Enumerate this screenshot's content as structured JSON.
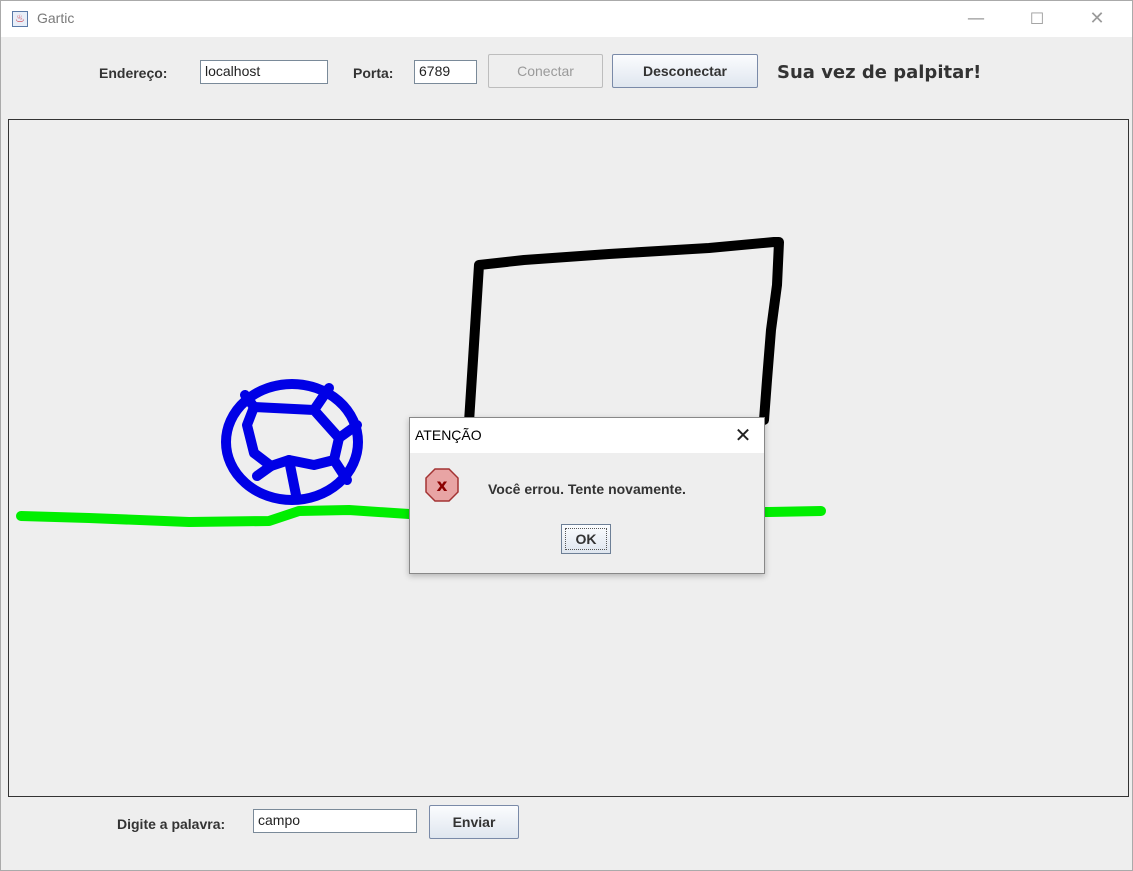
{
  "window": {
    "title": "Gartic",
    "icon": "java-app-icon",
    "controls": {
      "minimize": "—",
      "maximize": "☐",
      "close": "✕"
    }
  },
  "connection": {
    "address_label": "Endereço:",
    "address_value": "localhost",
    "port_label": "Porta:",
    "port_value": "6789",
    "connect_label": "Conectar",
    "disconnect_label": "Desconectar",
    "status_text": "Sua vez de palpitar!"
  },
  "drawing": {
    "stroke_colors": {
      "ball": "#0000e6",
      "goal": "#000000",
      "ground": "#00ee00"
    }
  },
  "guess": {
    "label": "Digite a palavra:",
    "input_value": "campo",
    "send_label": "Enviar"
  },
  "dialog": {
    "title": "ATENÇÃO",
    "close": "✕",
    "icon": "error-icon",
    "icon_glyph": "x",
    "message": "Você errou. Tente novamente.",
    "ok_label": "OK",
    "colors": {
      "error_fill": "#e8a4a4",
      "error_border": "#a33333",
      "error_mark": "#8b0000"
    }
  }
}
